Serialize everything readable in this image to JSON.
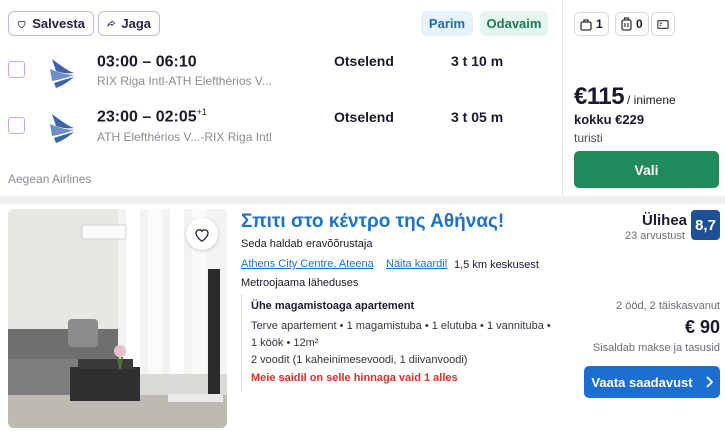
{
  "flight": {
    "save_label": "Salvesta",
    "share_label": "Jaga",
    "tag_best": "Parim",
    "tag_cheapest": "Odavaim",
    "bag_personal_count": "1",
    "bag_carry_count": "0",
    "legs": [
      {
        "time": "03:00 – 06:10",
        "plus_day": "",
        "route": "RIX Riga Intl-ATH Elefthérios V...",
        "stops": "Otselend",
        "duration": "3 t 10 m"
      },
      {
        "time": "23:00 – 02:05",
        "plus_day": "+1",
        "route": "ATH Elefthérios V...-RIX Riga Intl",
        "stops": "Otselend",
        "duration": "3 t 05 m"
      }
    ],
    "airline": "Aegean Airlines",
    "price": "€115",
    "per_person": "/ inimene",
    "total": "kokku €229",
    "cabin": "turisti",
    "select_label": "Vali"
  },
  "hotel": {
    "title": "Σπιτι στο κέντρο της Αθήνας!",
    "managed_by": "Seda haldab eravõõrustaja",
    "location_link": "Athens City Centre, Ateena",
    "map_link": "Näita kaardil",
    "distance": "1,5 km keskusest",
    "metro": "Metroojaama läheduses",
    "room_title": "Ühe magamistoaga apartement",
    "room_line1": "Terve apartement • 1 magamistuba • 1 elutuba • 1 vannituba •",
    "room_line2": "1 köök • 12m²",
    "room_line3": "2 voodit (1 kaheinimesevoodi, 1 diivanvoodi)",
    "price_note": "Meie saidil on selle hinnaga vaid 1 alles",
    "rating_word": "Ülihea",
    "reviews": "23 arvustust",
    "score": "8,7",
    "occupancy": "2 ööd, 2 täiskasvanut",
    "price": "€ 90",
    "taxes": "Sisaldab makse ja tasusid",
    "cta_label": "Vaata saadavust"
  },
  "colors": {
    "accent_purple": "#c9b3e8",
    "select_green": "#1f8a5c",
    "link_blue": "#1c73c9",
    "score_blue": "#1e4f99",
    "alert_red": "#d8322d"
  }
}
